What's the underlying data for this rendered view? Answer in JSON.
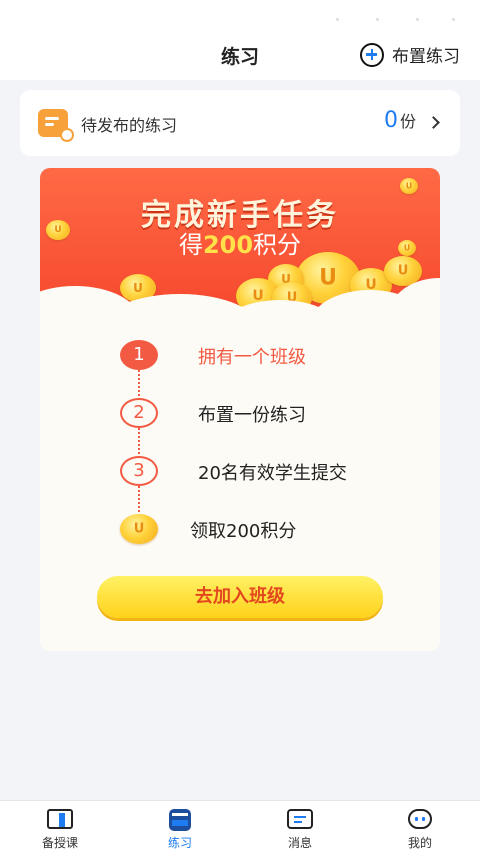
{
  "header": {
    "title": "练习",
    "action_label": "布置练习"
  },
  "pending": {
    "label": "待发布的练习",
    "count": "0",
    "unit": "份"
  },
  "task": {
    "title": "完成新手任务",
    "subtitle_prefix": "得",
    "subtitle_points": "200",
    "subtitle_suffix": "积分",
    "coin_glyph": "U",
    "steps": [
      {
        "number": "1",
        "label": "拥有一个班级"
      },
      {
        "number": "2",
        "label": "布置一份练习"
      },
      {
        "number": "3",
        "label": "20名有效学生提交"
      }
    ],
    "reward_label": "领取200积分",
    "button_label": "去加入班级"
  },
  "tabs": [
    {
      "label": "备授课",
      "icon": "book-icon"
    },
    {
      "label": "练习",
      "icon": "practice-icon"
    },
    {
      "label": "消息",
      "icon": "message-icon"
    },
    {
      "label": "我的",
      "icon": "profile-icon"
    }
  ],
  "colors": {
    "accent_blue": "#1e7cf2",
    "banner_red": "#f6472e",
    "step_red": "#f35a43",
    "button_yellow": "#ffd21a"
  }
}
